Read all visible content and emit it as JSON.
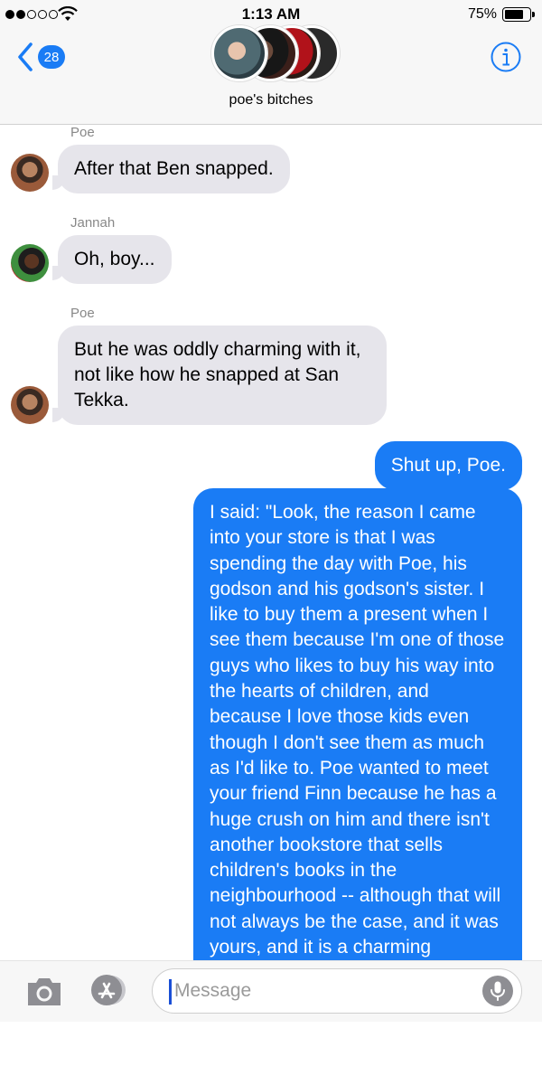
{
  "status_bar": {
    "time": "1:13 AM",
    "battery": "75%",
    "battery_level": 0.75
  },
  "header": {
    "back_count": "28",
    "group_name": "poe's bitches"
  },
  "messages": [
    {
      "sender": "Poe",
      "text": "After that Ben snapped.",
      "direction": "incoming"
    },
    {
      "sender": "Jannah",
      "text": "Oh, boy...",
      "direction": "incoming"
    },
    {
      "sender": "Poe",
      "text": "But he was oddly charming with it, not like how he snapped at San Tekka.",
      "direction": "incoming"
    },
    {
      "text": "Shut up, Poe.",
      "direction": "outgoing"
    },
    {
      "text": "I said: \"Look, the reason I came into your store is that I was spending the day with Poe, his godson and his godson's sister. I like to buy them a present when I see them because I'm one of those guys who likes to buy his way into the hearts of children, and because I love those kids even though I don't see them as much as I'd like to. Poe wanted to meet your friend Finn because he has a huge crush on him and there isn't another bookstore that sells children's books in the neighbourhood -- although that will not always be the case, and it was yours, and it is a charming",
      "direction": "outgoing"
    }
  ],
  "input": {
    "placeholder": "Message"
  },
  "colors": {
    "accent": "#1a7cf5",
    "incoming_bubble": "#e6e5eb"
  }
}
